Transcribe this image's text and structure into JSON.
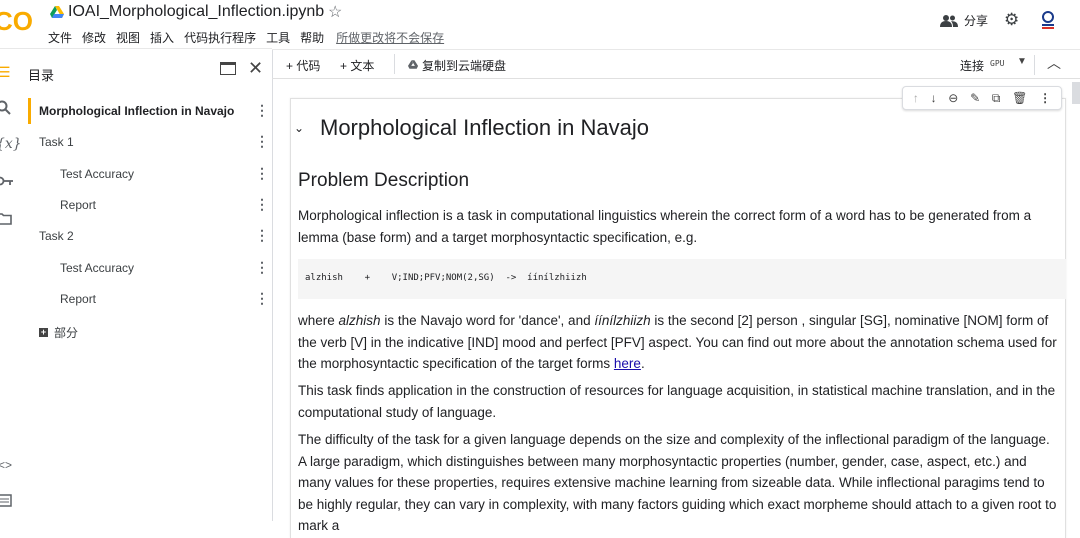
{
  "app": {
    "notebook_title": "IOAI_Morphological_Inflection.ipynb",
    "menu": [
      "文件",
      "修改",
      "视图",
      "插入",
      "代码执行程序",
      "工具",
      "帮助"
    ],
    "unsaved_notice": "所做更改将不会保存",
    "share_label": "分享"
  },
  "toolbar": {
    "add_code": "+ 代码",
    "add_text": "+ 文本",
    "copy_to_drive": "复制到云端硬盘",
    "connect": "连接",
    "runtime": "GPU"
  },
  "toc": {
    "header": "目录",
    "items": [
      {
        "label": "Morphological Inflection in Navajo",
        "level": 1,
        "active": true
      },
      {
        "label": "Task 1",
        "level": 1
      },
      {
        "label": "Test Accuracy",
        "level": 2
      },
      {
        "label": "Report",
        "level": 2
      },
      {
        "label": "Task 2",
        "level": 1
      },
      {
        "label": "Test Accuracy",
        "level": 2
      },
      {
        "label": "Report",
        "level": 2
      }
    ],
    "add_section": "部分"
  },
  "content": {
    "h1": "Morphological Inflection in Navajo",
    "h2": "Problem Description",
    "p1": "Morphological inflection is a task in computational linguistics wherein the correct form of a word has to be generated from a lemma (base form) and a target morphosyntactic specification, e.g.",
    "code": "alzhish    +    V;IND;PFV;NOM(2,SG)  ->  íínílzhiizh",
    "p2_a": "where ",
    "p2_alzhish": "alzhish",
    "p2_b": " is the Navajo word for 'dance', and ",
    "p2_inilzhiizh": "íínílzhiizh",
    "p2_c": " is the second [2] person , singular [SG], nominative [NOM] form of the verb [V] in the indicative [IND] mood and perfect [PFV] aspect. You can find out more about the annotation schema used for the morphosyntactic specification of the target forms ",
    "p2_link": "here",
    "p2_d": ".",
    "p3": "This task finds application in the construction of resources for language acquisition, in statistical machine translation, and in the computational study of language.",
    "p4": "The difficulty of the task for a given language depends on the size and complexity of the inflectional paradigm of the language. A large paradigm, which distinguishes between many morphosyntactic properties (number, gender, case, aspect, etc.) and many values for these properties, requires extensive machine learning from sizeable data. While inflectional paragims tend to be highly regular, they can vary in complexity, with many factors guiding which exact morpheme should attach to a given root to mark a"
  },
  "colors": {
    "logo_orange": "#f9ab00",
    "active_marker": "#f9ab00",
    "link": "#1a0dab"
  }
}
